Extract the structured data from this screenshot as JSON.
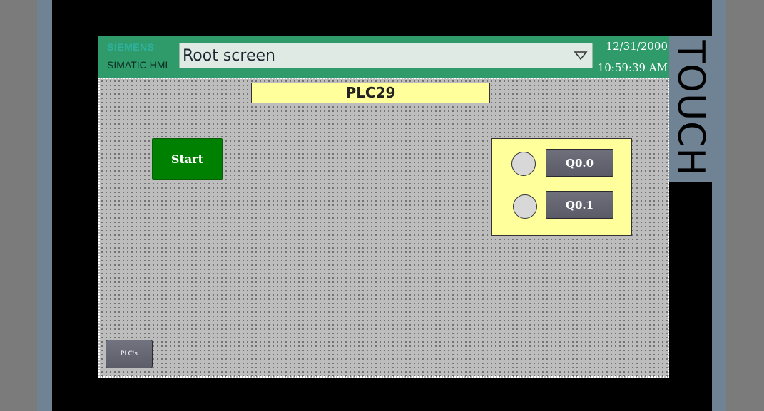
{
  "device": {
    "side_text": "TOUCH"
  },
  "header": {
    "brand": "SIEMENS",
    "product": "SIMATIC HMI",
    "screen_selector": "Root screen",
    "date": "12/31/2000",
    "time": "10:59:39 AM"
  },
  "screen": {
    "title": "PLC29",
    "start_label": "Start",
    "outputs": [
      {
        "label": "Q0.0"
      },
      {
        "label": "Q0.1"
      }
    ],
    "plcs_label": "PLC's"
  },
  "colors": {
    "header_bg": "#2f9b6b",
    "title_bg": "#ffff9c",
    "start_bg": "#008000",
    "button_bg": "#64656f",
    "lamp_off": "#d8d8d8"
  }
}
